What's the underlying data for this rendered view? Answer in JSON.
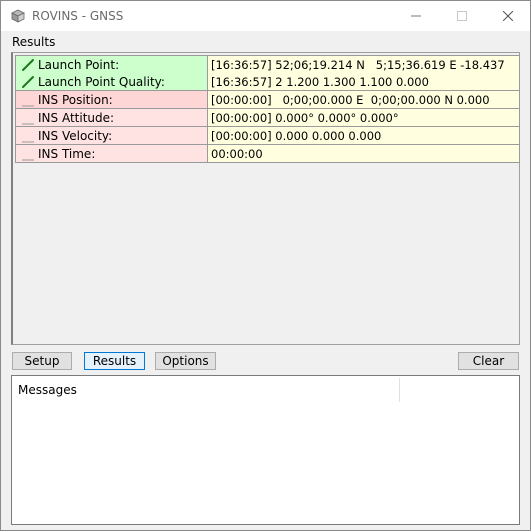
{
  "window": {
    "title": "ROVINS - GNSS",
    "icon": "app-box-icon"
  },
  "results_label": "Results",
  "rows": [
    {
      "name": "Launch Point:",
      "value": "[16:36:57] 52;06;19.214 N   5;15;36.619 E -18.437",
      "status": "ok",
      "status_icon": "check-icon"
    },
    {
      "name": "Launch Point Quality:",
      "value": "[16:36:57] 2 1.200 1.300 1.100 0.000",
      "status": "ok",
      "status_icon": "check-icon"
    },
    {
      "name": "INS Position:",
      "value": "[00:00:00]   0;00;00.000 E  0;00;00.000 N 0.000",
      "status": "bad",
      "status_icon": "dash-icon"
    },
    {
      "name": "INS Attitude:",
      "value": "[00:00:00] 0.000° 0.000° 0.000°",
      "status": "bad2",
      "status_icon": "dash-icon"
    },
    {
      "name": "INS Velocity:",
      "value": "[00:00:00] 0.000 0.000 0.000",
      "status": "bad2",
      "status_icon": "dash-icon"
    },
    {
      "name": "INS Time:",
      "value": "00:00:00",
      "status": "bad2",
      "status_icon": "dash-icon"
    }
  ],
  "buttons": {
    "setup": "Setup",
    "results": "Results",
    "options": "Options",
    "clear": "Clear"
  },
  "messages": {
    "header": "Messages"
  },
  "colors": {
    "ok": "#ccffcc",
    "bad": "#ffd6d6",
    "value_bg": "#ffffe0",
    "check": "#1e7a1e",
    "active_border": "#0078d7"
  }
}
